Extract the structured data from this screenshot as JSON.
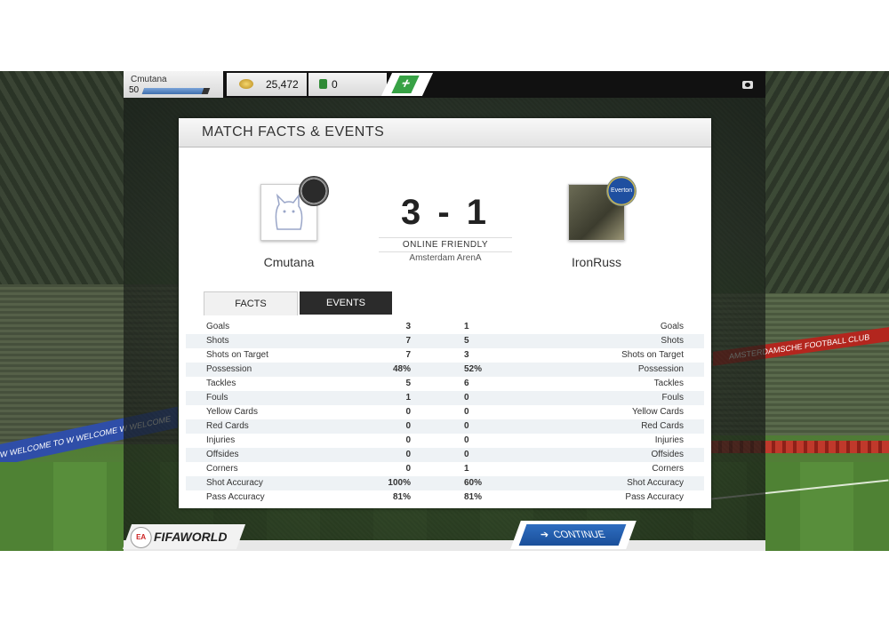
{
  "topbar": {
    "username": "Cmutana",
    "level": "50",
    "xp_progress": 0.9,
    "coins": "25,472",
    "points": "0",
    "add_button": "+"
  },
  "panel": {
    "title": "MATCH FACTS & EVENTS",
    "home_team": "Cmutana",
    "away_team": "IronRuss",
    "score": "3 - 1",
    "competition": "ONLINE FRIENDLY",
    "venue": "Amsterdam ArenA",
    "away_crest_text": "Everton",
    "tabs": {
      "facts": "FACTS",
      "events": "EVENTS"
    }
  },
  "stats": [
    {
      "label": "Goals",
      "home": "3",
      "away": "1"
    },
    {
      "label": "Shots",
      "home": "7",
      "away": "5"
    },
    {
      "label": "Shots on Target",
      "home": "7",
      "away": "3"
    },
    {
      "label": "Possession",
      "home": "48%",
      "away": "52%"
    },
    {
      "label": "Tackles",
      "home": "5",
      "away": "6"
    },
    {
      "label": "Fouls",
      "home": "1",
      "away": "0"
    },
    {
      "label": "Yellow Cards",
      "home": "0",
      "away": "0"
    },
    {
      "label": "Red Cards",
      "home": "0",
      "away": "0"
    },
    {
      "label": "Injuries",
      "home": "0",
      "away": "0"
    },
    {
      "label": "Offsides",
      "home": "0",
      "away": "0"
    },
    {
      "label": "Corners",
      "home": "0",
      "away": "1"
    },
    {
      "label": "Shot Accuracy",
      "home": "100%",
      "away": "60%"
    },
    {
      "label": "Pass Accuracy",
      "home": "81%",
      "away": "81%"
    }
  ],
  "footer": {
    "logo_text": "FIFAWORLD",
    "ea_badge": "EA",
    "continue_label": "CONTINUE",
    "continue_arrow": "➔"
  },
  "background": {
    "ad_left": "W WELCOME TO W WELCOME W WELCOME",
    "ad_right": "AMSTERDAMSCHE FOOTBALL CLUB"
  },
  "colors": {
    "accent_blue": "#1f5aa8",
    "plus_green": "#37a245",
    "panel_bg": "#ffffff"
  },
  "icons": {
    "coins": "coins-icon",
    "points": "points-icon",
    "camera": "camera-icon",
    "continue": "arrow-right-icon"
  }
}
